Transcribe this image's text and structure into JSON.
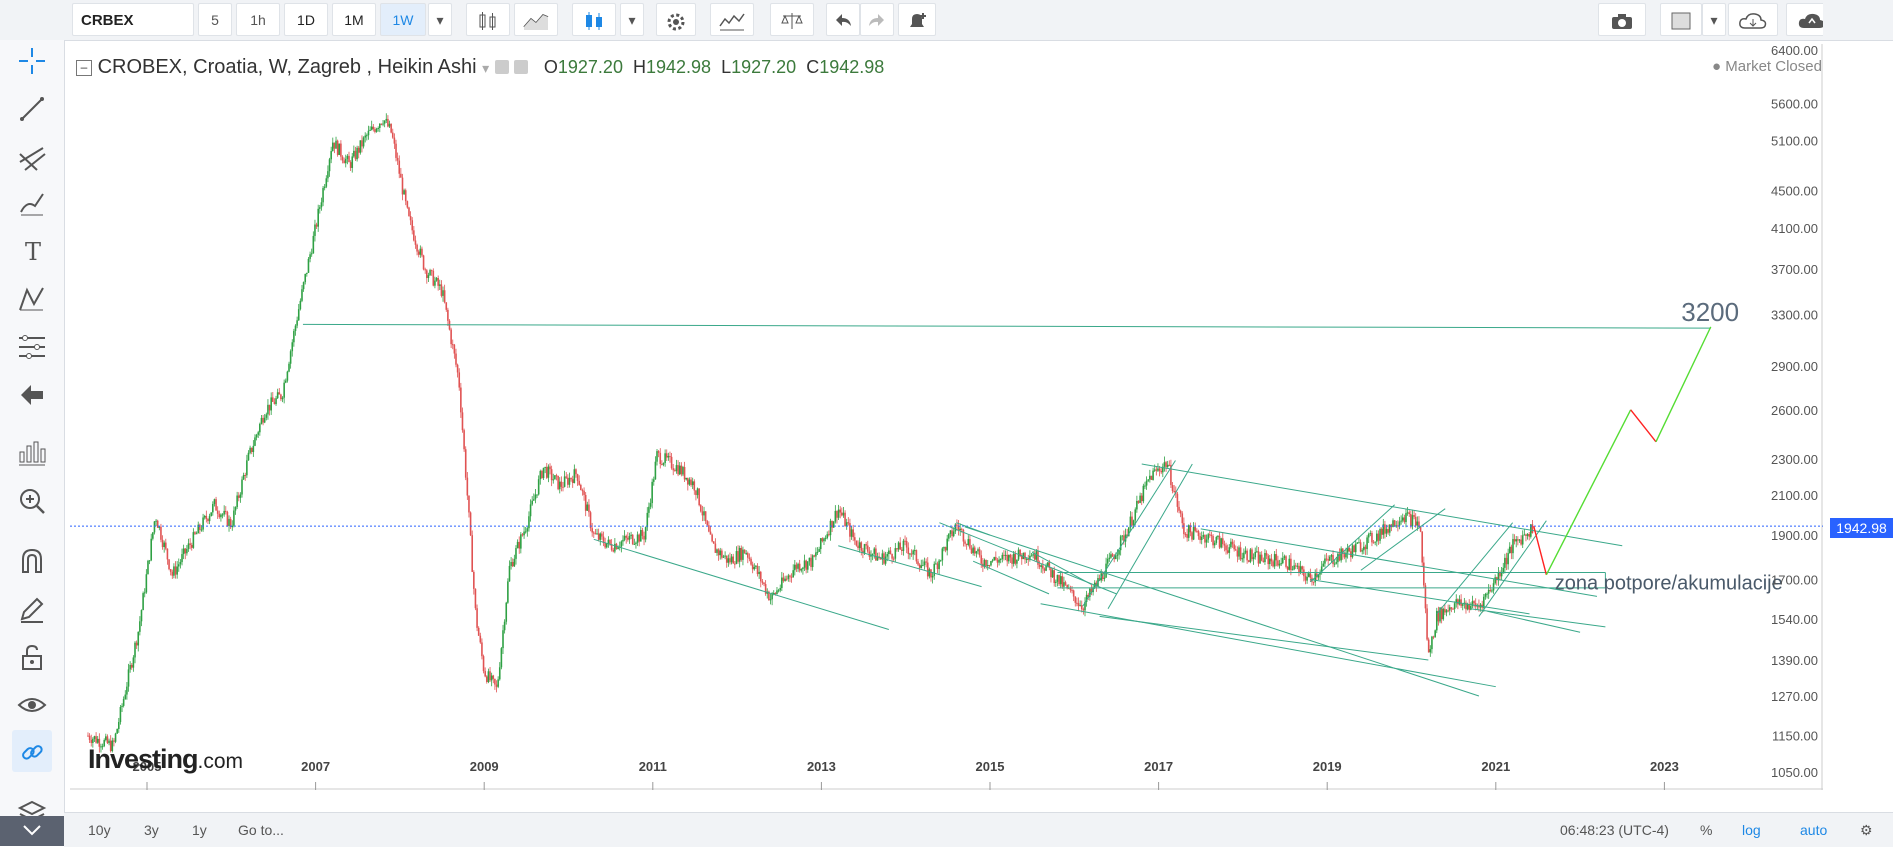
{
  "toolbar": {
    "symbol": "CRBEX",
    "intervals": [
      "5",
      "1h",
      "1D",
      "1M",
      "1W"
    ],
    "active_interval": "1W"
  },
  "legend": {
    "title": "CROBEX, Croatia, W, Zagreb , Heikin Ashi",
    "open_label": "O",
    "open": "1927.20",
    "high_label": "H",
    "high": "1942.98",
    "low_label": "L",
    "low": "1927.20",
    "close_label": "C",
    "close": "1942.98"
  },
  "market_status": "Market Closed",
  "brand": {
    "name": "Investing",
    "suffix": ".com"
  },
  "bottom": {
    "ranges": [
      "10y",
      "3y",
      "1y"
    ],
    "goto": "Go to...",
    "time": "06:48:23 (UTC-4)",
    "percent": "%",
    "log": "log",
    "auto": "auto"
  },
  "colors": {
    "up": "#26a69a",
    "candle_up": "#2ea043",
    "candle_down": "#e05252",
    "drawing": "#3aa88a",
    "projection_up": "#55dd33",
    "projection_down": "#ff2222",
    "price_line": "#2962ff"
  },
  "icons": [
    "crosshair-icon",
    "trendline-icon",
    "pitchfork-icon",
    "brush-icon",
    "text-icon",
    "pattern-icon",
    "fib-icon",
    "back-arrow-icon",
    "measure-icon",
    "zoom-icon",
    "magnet-icon",
    "lock-pencil-icon",
    "lock-icon",
    "eye-icon",
    "link-icon",
    "layers-icon"
  ],
  "chart_data": {
    "type": "candlestick",
    "chart_style": "Heikin Ashi",
    "y_scale": "log",
    "x_ticks": [
      "2005",
      "2007",
      "2009",
      "2011",
      "2013",
      "2015",
      "2017",
      "2019",
      "2021",
      "2023"
    ],
    "y_ticks": [
      6400,
      5600,
      5100,
      4500,
      4100,
      3700,
      3300,
      2900,
      2600,
      2300,
      2100,
      1900,
      1700,
      1540,
      1390,
      1270,
      1150,
      1050
    ],
    "y_tick_labels": [
      "6400.00",
      "5600.00",
      "5100.00",
      "4500.00",
      "4100.00",
      "3700.00",
      "3300.00",
      "2900.00",
      "2600.00",
      "2300.00",
      "2100.00",
      "1900.00",
      "1700.00",
      "1540.00",
      "1390.00",
      "1270.00",
      "1150.00",
      "1050.00"
    ],
    "current_price": "1942.98",
    "annotations": [
      {
        "text": "3200",
        "value": 3200
      },
      {
        "text": "zona potpore/akumulacije"
      }
    ],
    "series": [
      {
        "x": [
          2004.3,
          2004.6,
          2004.9,
          2005.1,
          2005.3,
          2005.5,
          2005.8,
          2006.0,
          2006.2,
          2006.4,
          2006.6,
          2006.8,
          2007.0,
          2007.2,
          2007.4,
          2007.6,
          2007.8,
          2007.9,
          2008.1,
          2008.3,
          2008.5,
          2008.7,
          2008.8,
          2008.9,
          2009.0,
          2009.15,
          2009.3,
          2009.5,
          2009.7,
          2009.9,
          2010.1,
          2010.3,
          2010.5,
          2010.7,
          2010.9,
          2011.05,
          2011.3,
          2011.5,
          2011.7,
          2011.9,
          2012.1,
          2012.4,
          2012.7,
          2012.9,
          2013.2,
          2013.4,
          2013.7,
          2014.0,
          2014.3,
          2014.6,
          2014.9,
          2015.2,
          2015.5,
          2015.8,
          2016.1,
          2016.3,
          2016.6,
          2016.9,
          2017.1,
          2017.3,
          2017.6,
          2017.9,
          2018.2,
          2018.5,
          2018.8,
          2019.0,
          2019.3,
          2019.6,
          2019.9,
          2020.1,
          2020.2,
          2020.3,
          2020.5,
          2020.8,
          2021.0,
          2021.2,
          2021.45
        ],
        "values": [
          1150,
          1120,
          1500,
          2000,
          1720,
          1850,
          2050,
          1950,
          2300,
          2600,
          2700,
          3350,
          4100,
          5100,
          4800,
          5150,
          5400,
          5200,
          4200,
          3700,
          3500,
          2800,
          2100,
          1550,
          1350,
          1290,
          1750,
          1950,
          2250,
          2150,
          2220,
          1900,
          1850,
          1880,
          1900,
          2320,
          2250,
          2150,
          1850,
          1780,
          1830,
          1620,
          1760,
          1780,
          2030,
          1870,
          1790,
          1850,
          1720,
          1950,
          1780,
          1790,
          1820,
          1700,
          1590,
          1700,
          1900,
          2200,
          2280,
          1920,
          1890,
          1830,
          1790,
          1780,
          1700,
          1780,
          1830,
          1900,
          2000,
          1950,
          1400,
          1550,
          1600,
          1590,
          1700,
          1850,
          1943
        ]
      }
    ]
  }
}
